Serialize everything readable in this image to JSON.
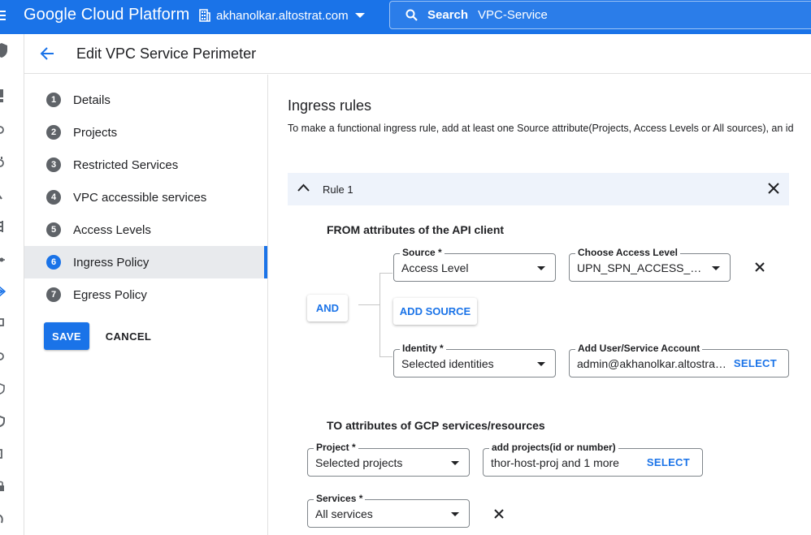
{
  "topbar": {
    "brand": "Google Cloud Platform",
    "org": "akhanolkar.altostrat.com",
    "search_label": "Search",
    "search_value": "VPC-Service"
  },
  "header": {
    "title": "Edit VPC Service Perimeter"
  },
  "stepper": {
    "steps": [
      {
        "num": "1",
        "label": "Details"
      },
      {
        "num": "2",
        "label": "Projects"
      },
      {
        "num": "3",
        "label": "Restricted Services"
      },
      {
        "num": "4",
        "label": "VPC accessible services"
      },
      {
        "num": "5",
        "label": "Access Levels"
      },
      {
        "num": "6",
        "label": "Ingress Policy"
      },
      {
        "num": "7",
        "label": "Egress Policy"
      }
    ],
    "active_step": "6",
    "save_label": "SAVE",
    "cancel_label": "CANCEL"
  },
  "main": {
    "title": "Ingress rules",
    "description": "To make a functional ingress rule, add at least one Source attribute(Projects, Access Levels or All sources), an id",
    "rule_label": "Rule 1",
    "from": {
      "heading": "FROM attributes of the API client",
      "and_label": "AND",
      "add_source_label": "ADD SOURCE",
      "source": {
        "label": "Source *",
        "value": "Access Level"
      },
      "access_level": {
        "label": "Choose Access Level",
        "value": "UPN_SPN_ACCESS_LVL a..."
      },
      "identity": {
        "label": "Identity *",
        "value": "Selected identities"
      },
      "user_account": {
        "label": "Add User/Service Account",
        "value": "admin@akhanolkar.altostrat.co",
        "action": "SELECT"
      }
    },
    "to": {
      "heading": "TO attributes of GCP services/resources",
      "project": {
        "label": "Project *",
        "value": "Selected projects"
      },
      "add_projects": {
        "label": "add projects(id or number)",
        "value": "thor-host-proj and 1 more",
        "action": "SELECT"
      },
      "services": {
        "label": "Services *",
        "value": "All services"
      }
    }
  },
  "colors": {
    "brand_blue": "#1a73e8",
    "rule_bar": "#eef3fb"
  }
}
